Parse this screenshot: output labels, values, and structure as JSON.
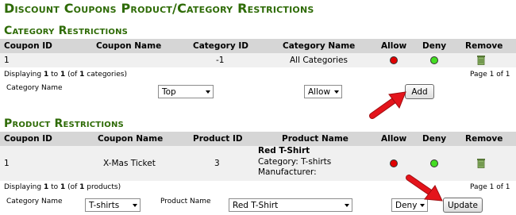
{
  "page_title": "Discount Coupons Product/Category Restrictions",
  "category_section": {
    "title": "Category Restrictions",
    "columns": [
      "Coupon ID",
      "Coupon Name",
      "Category ID",
      "Category Name",
      "Allow",
      "Deny",
      "Remove"
    ],
    "row": {
      "coupon_id": "1",
      "coupon_name": "",
      "category_id": "-1",
      "category_name": "All Categories"
    },
    "displaying": {
      "prefix": "Displaying ",
      "from": "1",
      "to_word": " to ",
      "to": "1",
      "of_open": " (of ",
      "total": "1",
      "suffix": " categories)"
    },
    "page_info": "Page 1 of 1",
    "form": {
      "label": "Category Name",
      "category_select": "Top",
      "action_select": "Allow",
      "add_button": "Add"
    }
  },
  "product_section": {
    "title": "Product Restrictions",
    "columns": [
      "Coupon ID",
      "Coupon Name",
      "Product ID",
      "Product Name",
      "Allow",
      "Deny",
      "Remove"
    ],
    "row": {
      "coupon_id": "1",
      "coupon_name": "X-Mas Ticket",
      "product_id": "3",
      "product_name": "Red T-Shirt",
      "category_line": "Category: T-shirts",
      "manufacturer_line": "Manufacturer:"
    },
    "displaying": {
      "prefix": "Displaying ",
      "from": "1",
      "to_word": " to ",
      "to": "1",
      "of_open": " (of ",
      "total": "1",
      "suffix": " products)"
    },
    "page_info": "Page 1 of 1",
    "form": {
      "category_label": "Category Name",
      "category_select": "T-shirts",
      "product_label": "Product Name",
      "product_select": "Red T-Shirt",
      "action_select": "Deny",
      "update_button": "Update"
    }
  },
  "colors": {
    "heading_green": "#2e6b06",
    "header_bg": "#d6d6d6",
    "row_bg": "#f0f0f0",
    "arrow_red": "#e4141b"
  },
  "icons": {
    "allow": "red-dot-icon",
    "deny": "green-dot-icon",
    "remove": "trash-can-icon",
    "pointer": "red-arrow-icon"
  }
}
